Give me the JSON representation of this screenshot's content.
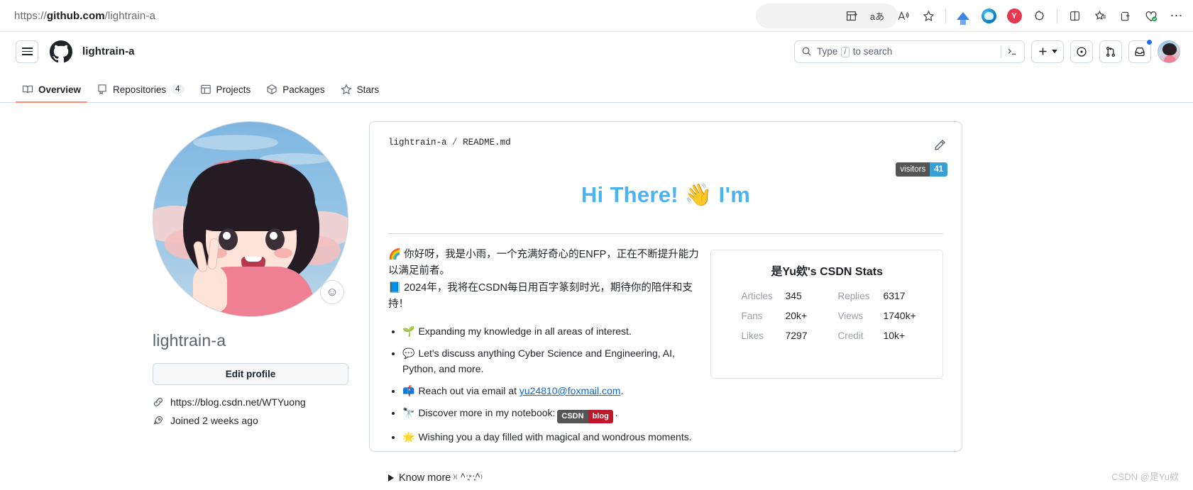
{
  "browser": {
    "url_prefix": "https://",
    "url_bold": "github.com",
    "url_suffix": "/lightrain-a",
    "icons": [
      {
        "name": "split-screen-icon",
        "glyph": "⊞"
      },
      {
        "name": "translate-icon",
        "glyph": "aあ"
      },
      {
        "name": "read-aloud-icon",
        "glyph": "A"
      },
      {
        "name": "favorite-star-icon",
        "glyph": "☆"
      },
      {
        "name": "downloads-icon",
        "glyph": "↓"
      },
      {
        "name": "edge-copilot-icon",
        "glyph": "e"
      },
      {
        "name": "extension-red-icon",
        "glyph": "Y"
      },
      {
        "name": "extensions-puzzle-icon",
        "glyph": "❁"
      },
      {
        "name": "browser-essentials-icon",
        "glyph": "◫"
      },
      {
        "name": "collections-icon",
        "glyph": "☆"
      },
      {
        "name": "add-tab-icon",
        "glyph": "⊕"
      },
      {
        "name": "profile-health-icon",
        "glyph": "♡"
      },
      {
        "name": "settings-more-icon",
        "glyph": "⋯"
      }
    ]
  },
  "header": {
    "menu_label": "menu",
    "owner": "lightrain-a",
    "search_placeholder_pre": "Type",
    "search_key": "/",
    "search_placeholder_post": "to search",
    "terminal_glyph": ">_",
    "create_glyph": "+",
    "issues_glyph": "⊙",
    "pulls_glyph": "⑂",
    "inbox_glyph": "✉"
  },
  "nav": {
    "tabs": [
      {
        "label": "Overview",
        "icon": "book-icon",
        "glyph": "▤",
        "count": null,
        "active": true
      },
      {
        "label": "Repositories",
        "icon": "repo-icon",
        "glyph": "▣",
        "count": "4",
        "active": false
      },
      {
        "label": "Projects",
        "icon": "table-icon",
        "glyph": "▦",
        "count": null,
        "active": false
      },
      {
        "label": "Packages",
        "icon": "package-icon",
        "glyph": "◈",
        "count": null,
        "active": false
      },
      {
        "label": "Stars",
        "icon": "star-icon",
        "glyph": "☆",
        "count": null,
        "active": false
      }
    ]
  },
  "profile": {
    "username": "lightrain-a",
    "edit_button": "Edit profile",
    "status_emoji": "☺",
    "website": "https://blog.csdn.net/WTYuong",
    "joined": "Joined 2 weeks ago",
    "link_icon": "link-icon",
    "rocket_icon": "rocket-icon"
  },
  "readme": {
    "owner": "lightrain-a",
    "separator": "/",
    "file": "README.md",
    "edit_icon": "pencil-icon",
    "visitors_label": "visitors",
    "visitors_count": "41",
    "heading": "Hi There! 👋 I'm",
    "bio_line1": "🌈 你好呀，我是小雨，一个充满好奇心的ENFP，正在不断提升能力以满足前者。",
    "bio_line2": "📘 2024年，我将在CSDN每日用百字篆刻时光，期待你的陪伴和支持！",
    "bullets": [
      {
        "emoji": "🌱",
        "text": "Expanding my knowledge in all areas of interest.",
        "link": null,
        "badge": null,
        "tail": ""
      },
      {
        "emoji": "💬",
        "text": "Let's discuss anything Cyber Science and Engineering, AI, Python, and more.",
        "link": null,
        "badge": null,
        "tail": ""
      },
      {
        "emoji": "📫",
        "text": "Reach out via email at ",
        "link": "yu24810@foxmail.com",
        "badge": null,
        "tail": "."
      },
      {
        "emoji": "🔭",
        "text": "Discover more in my notebook:",
        "link": null,
        "badge": {
          "left": "CSDN",
          "right": "blog"
        },
        "tail": "."
      },
      {
        "emoji": "🌟",
        "text": "Wishing you a day filled with magical and wondrous moments.",
        "link": null,
        "badge": null,
        "tail": ""
      }
    ],
    "know_more": "Know more",
    "know_more_emoticon": "₎₍ ˄·͈༝·͈˄₎"
  },
  "stats": {
    "title": "是Yu欸's CSDN Stats",
    "rows": [
      {
        "k1": "Articles",
        "v1": "345",
        "k2": "Replies",
        "v2": "6317"
      },
      {
        "k1": "Fans",
        "v1": "20k+",
        "k2": "Views",
        "v2": "1740k+"
      },
      {
        "k1": "Likes",
        "v1": "7297",
        "k2": "Credit",
        "v2": "10k+"
      }
    ]
  },
  "watermark": "CSDN @是Yu欸",
  "colors": {
    "accent_blue": "#4ab3f4",
    "badge_blue": "#3a9fd4",
    "badge_gray": "#555555",
    "badge_red": "#c0172b",
    "tab_underline": "#fd8c73",
    "link": "#0969da"
  }
}
